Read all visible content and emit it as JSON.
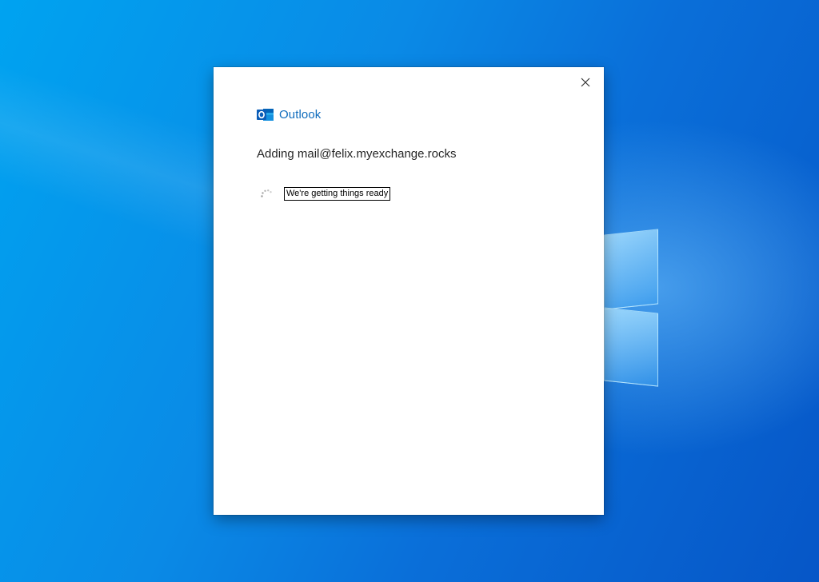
{
  "dialog": {
    "brand_name": "Outlook",
    "heading": "Adding mail@felix.myexchange.rocks",
    "status_text": "We're getting things ready",
    "icons": {
      "brand": "outlook-logo-icon",
      "close": "close-icon",
      "status": "loading-spinner-icon"
    }
  },
  "colors": {
    "brand": "#0f6cbd",
    "desktop_background": "#0a78e0"
  }
}
